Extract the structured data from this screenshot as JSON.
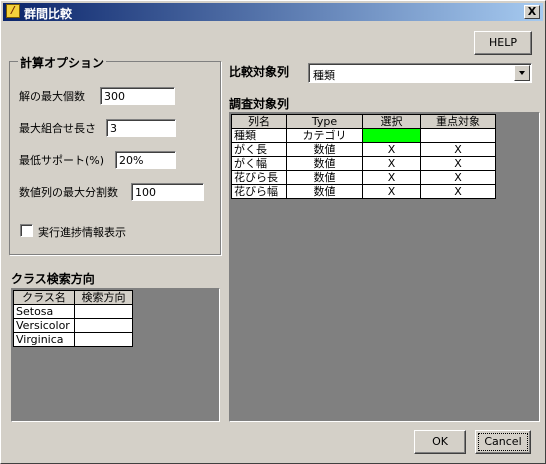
{
  "window": {
    "title": "群間比較",
    "close_label": "X"
  },
  "help_button": "HELP",
  "options": {
    "legend": "計算オプション",
    "max_solutions": {
      "label": "解の最大個数",
      "value": "300"
    },
    "max_combination_length": {
      "label": "最大組合せ長さ",
      "value": "3"
    },
    "min_support": {
      "label": "最低サポート(%)",
      "value": "20%"
    },
    "max_divisions": {
      "label": "数値列の最大分割数",
      "value": "100"
    },
    "progress_checkbox_label": "実行進捗情報表示"
  },
  "class_direction": {
    "title": "クラス検索方向",
    "columns": [
      "クラス名",
      "検索方向"
    ],
    "rows": [
      [
        "Setosa",
        ""
      ],
      [
        "Versicolor",
        ""
      ],
      [
        "Virginica",
        ""
      ]
    ]
  },
  "comparison": {
    "label": "比較対象列",
    "selected": "種類"
  },
  "survey": {
    "title": "調査対象列",
    "columns": [
      "列名",
      "Type",
      "選択",
      "重点対象"
    ],
    "rows": [
      [
        "種類",
        "カテゴリ",
        "",
        ""
      ],
      [
        "がく長",
        "数値",
        "X",
        "X"
      ],
      [
        "がく幅",
        "数値",
        "X",
        "X"
      ],
      [
        "花びら長",
        "数値",
        "X",
        "X"
      ],
      [
        "花びら幅",
        "数値",
        "X",
        "X"
      ]
    ],
    "highlight_color": "#00ff00"
  },
  "buttons": {
    "ok": "OK",
    "cancel": "Cancel"
  }
}
